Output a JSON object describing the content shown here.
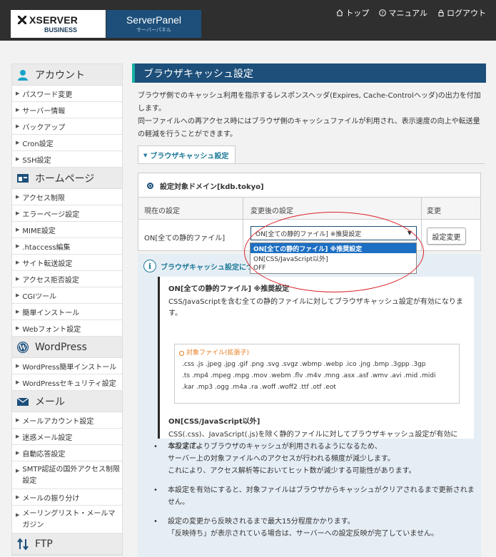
{
  "header": {
    "logo_main": "XSERVER",
    "logo_sub": "BUSINESS",
    "panel_title": "ServerPanel",
    "panel_sub": "サーバーパネル",
    "nav": [
      {
        "label": "トップ",
        "icon": "home-icon"
      },
      {
        "label": "マニュアル",
        "icon": "help-icon"
      },
      {
        "label": "ログアウト",
        "icon": "lock-icon"
      }
    ]
  },
  "sidebar": {
    "account": {
      "title": "アカウント",
      "items": [
        "パスワード変更",
        "サーバー情報",
        "バックアップ",
        "Cron設定",
        "SSH設定"
      ]
    },
    "homepage": {
      "title": "ホームページ",
      "items": [
        "アクセス制限",
        "エラーページ設定",
        "MIME設定",
        ".htaccess編集",
        "サイト転送設定",
        "アクセス拒否設定",
        "CGIツール",
        "簡単インストール",
        "Webフォント設定"
      ]
    },
    "wordpress": {
      "title": "WordPress",
      "items": [
        "WordPress簡単インストール",
        "WordPressセキュリティ設定"
      ]
    },
    "mail": {
      "title": "メール",
      "items": [
        "メールアカウント設定",
        "迷惑メール設定",
        "自動応答設定",
        "SMTP認証の国外アクセス制限設定",
        "メールの振り分け",
        "メーリングリスト・メールマガジン"
      ]
    },
    "ftp": {
      "title": "FTP"
    }
  },
  "main": {
    "title": "ブラウザキャッシュ設定",
    "desc1": "ブラウザ側でのキャッシュ利用を指示するレスポンスヘッダ(Expires, Cache-Controlヘッダ)の出力を付加します。",
    "desc2": "同一ファイルへの再アクセス時にはブラウザ側のキャッシュファイルが利用され、表示速度の向上や転送量の軽減を行うことができます。",
    "tab": "ブラウザキャッシュ設定",
    "domain_label": "設定対象ドメイン[kdb.tokyo]",
    "columns": [
      "現在の設定",
      "変更後の設定",
      "変更"
    ],
    "current_value": "ON[全ての静的ファイル]",
    "select_value": "ON[全ての静的ファイル] ※推奨設定",
    "change_button": "設定変更",
    "options": [
      "ON[全ての静的ファイル] ※推奨設定",
      "ON[CSS/JavaScript以外]",
      "OFF"
    ],
    "info_title": "ブラウザキャッシュ設定について",
    "opt1_title": "ON[全ての静的ファイル] ※推奨設定",
    "opt1_desc": "CSS/JavaScriptを含む全ての静的ファイルに対してブラウザキャッシュ設定が有効になります。",
    "ext_label": "対象ファイル(拡張子)",
    "ext_lines": [
      ".css .js .jpeg .jpg .gif .png .svg .svgz .wbmp .webp .ico .jng .bmp .3gpp .3gp",
      ".ts .mp4 .mpeg .mpg .mov .webm .flv .m4v .mng .asx .asf .wmv .avi .mid .midi",
      ".kar .mp3 .ogg .m4a .ra .woff .woff2 .ttf .otf .eot"
    ],
    "opt2_title": "ON[CSS/JavaScript以外]",
    "opt2_desc": "CSS(.css)、JavaScript(.js)を除く静的ファイルに対してブラウザキャッシュ設定が有効になります。",
    "notes": [
      [
        "本設定によりブラウザのキャッシュが利用されるようになるため、",
        "サーバー上の対象ファイルへのアクセスが行われる頻度が減少します。",
        "これにより、アクセス解析等においてヒット数が減少する可能性があります。"
      ],
      [
        "本設定を有効にすると、対象ファイルはブラウザからキャッシュがクリアされるまで更新されません。"
      ],
      [
        "設定の変更から反映されるまで最大15分程度かかります。",
        "「反映待ち」が表示されている場合は、サーバーへの設定反映が完了していません。"
      ]
    ]
  },
  "colors": {
    "header_bg": "#2f2f2f",
    "panel_blue": "#1d4f7a",
    "accent_teal": "#17b0a3",
    "highlight": "#1d6fc4",
    "annotation_red": "#d9242a"
  }
}
